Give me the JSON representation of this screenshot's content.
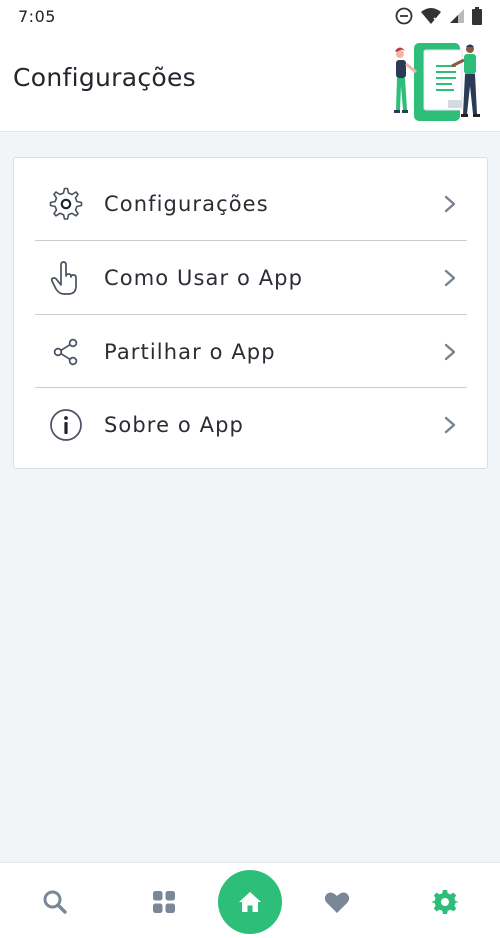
{
  "status_bar": {
    "time": "7:05",
    "icons": [
      "do-not-disturb-icon",
      "wifi-icon",
      "cell-signal-icon",
      "battery-icon"
    ]
  },
  "header": {
    "title": "Configurações",
    "illustration": "people-document-illustration"
  },
  "menu": {
    "items": [
      {
        "label": "Configurações",
        "icon": "gear-icon"
      },
      {
        "label": "Como Usar o App",
        "icon": "hand-pointer-icon"
      },
      {
        "label": "Partilhar o App",
        "icon": "share-icon"
      },
      {
        "label": "Sobre o App",
        "icon": "info-icon"
      }
    ]
  },
  "bottom_nav": {
    "items": [
      {
        "icon": "search-icon"
      },
      {
        "icon": "grid-icon"
      },
      {
        "icon": "home-icon",
        "active_style": "filled-circle"
      },
      {
        "icon": "heart-icon"
      },
      {
        "icon": "gear-icon",
        "selected": true
      }
    ]
  },
  "colors": {
    "accent": "#2dbf7a",
    "icon_gray": "#7a8799",
    "text": "#23262d",
    "background": "#f2f5f8"
  }
}
